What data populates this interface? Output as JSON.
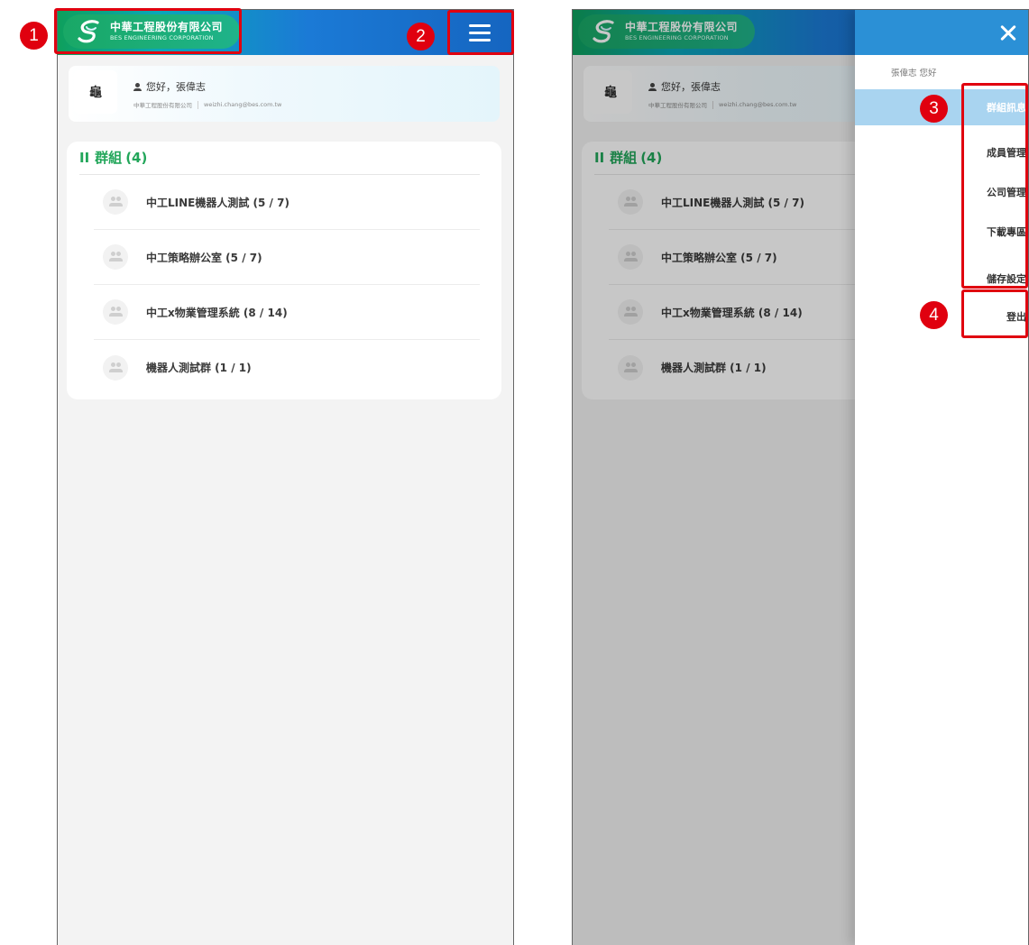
{
  "company": {
    "name_zh": "中華工程股份有限公司",
    "name_en": "BES ENGINEERING CORPORATION"
  },
  "user": {
    "avatar_text": "龜",
    "greeting": "您好，張偉志",
    "company": "中華工程股份有限公司",
    "email": "weizhi.chang@bes.com.tw"
  },
  "groups": {
    "bars": "II",
    "title": "群組",
    "count": "(4)",
    "items": [
      {
        "label": "中工LINE機器人測試 (5 / 7)"
      },
      {
        "label": "中工策略辦公室 (5 / 7)"
      },
      {
        "label": "中工x物業管理系統 (8 / 14)"
      },
      {
        "label": "機器人測試群 (1 / 1)"
      }
    ]
  },
  "drawer": {
    "greeting": "張偉志 您好",
    "menu": [
      {
        "label": "群組訊息",
        "active": true
      },
      {
        "label": "成員管理",
        "active": false
      },
      {
        "label": "公司管理",
        "active": false
      },
      {
        "label": "下載專區",
        "active": false
      },
      {
        "label": "儲存設定",
        "active": false
      }
    ],
    "logout": "登出"
  },
  "annotations": [
    "1",
    "2",
    "3",
    "4"
  ],
  "colors": {
    "brand_green": "#22a65a",
    "header_blue": "#1b7ad6",
    "drawer_header": "#2b90d6",
    "active_item": "#a9d4f0",
    "callout_red": "#e0000f"
  },
  "icons": [
    "company-logo-icon",
    "hamburger-menu-icon",
    "user-icon",
    "group-icon",
    "close-icon"
  ]
}
